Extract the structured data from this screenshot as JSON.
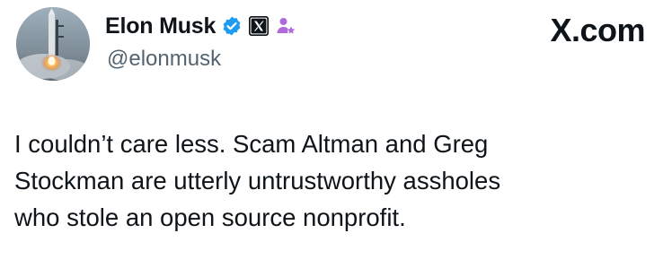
{
  "author": {
    "display_name": "Elon Musk",
    "handle": "@elonmusk",
    "avatar_icon": "rocket-launch-avatar",
    "badges": [
      "verified-check-icon",
      "x-affiliate-icon",
      "user-star-icon"
    ]
  },
  "brand": {
    "site": "X.com"
  },
  "tweet": {
    "lines": [
      "I couldn’t care less. Scam Altman and Greg",
      "Stockman are utterly untrustworthy assholes",
      "who stole an open source nonprofit."
    ]
  },
  "colors": {
    "text": "#0f1419",
    "secondary": "#536471",
    "verified_blue": "#1d9bf0",
    "affiliate_purple": "#b06ad9"
  }
}
